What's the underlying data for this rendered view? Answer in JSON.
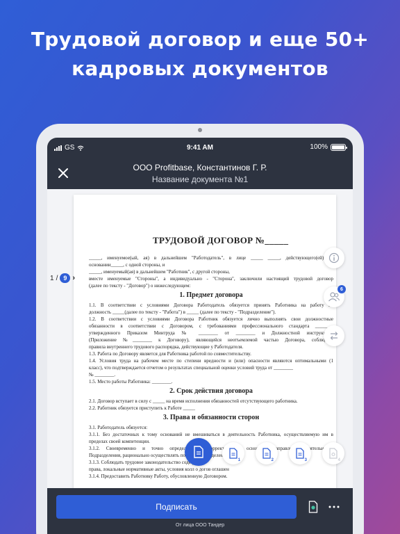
{
  "headline": {
    "line1": "Трудовой договор и еще 50+",
    "line2": "кадровых документов"
  },
  "status_bar": {
    "carrier": "GS",
    "time": "9:41 AM",
    "battery": "100%"
  },
  "header": {
    "title": "ООО Profitbase, Константинов Г. Р.",
    "subtitle": "Название документа №1"
  },
  "pager": {
    "current": "1",
    "separator": "/",
    "total": "9"
  },
  "document": {
    "title": "ТРУДОВОЙ ДОГОВОР №_____",
    "lines": [
      "_____, именуемое(ый, ая) в дальнейшем \"Работодатель\", в лице _____ _____, действующего(ей) на",
      "основании_____, с одной стороны, и",
      "_____, именуемый(ая) в дальнейшем \"Работник\", с другой стороны,",
      "вместе именуемые \"Стороны\", а индивидуально - \"Сторона\", заключили настоящий трудовой договор",
      "(далее по тексту - \"Договор\") о нижеследующем:"
    ],
    "section1": "1. Предмет договора",
    "section1_lines": [
      "1.1. В соответствии с условиями Договора Работодатель обязуется принять Работника на работу на",
      "должность _____(далее по тексту - \"Работа\") в _____ (далее по тексту - \"Подразделение\").",
      "1.2. В соответствии с условиями Договора Работник обязуется лично выполнять свои должностные",
      "обязанности в соответствии с Договором, с требованиями профессионального стандарта _______,",
      "утвержденного Приказом Минтруда № ________ от ________ и Должностной инструкцией",
      "(Приложение №________ к Договору), являющейся неотъемлемой частью Договора, соблюдать",
      "правила внутреннего трудового распорядка, действующие у Работодателя.",
      "1.3. Работа по Договору является для Работника работой по совместительству.",
      "1.4. Условия труда на рабочем месте по степени вредности и (или) опасности являются оптимальными (1",
      "класс), что подтверждается отчетом о результатах специальной оценки условий труда от ________",
      "№ ________.",
      "1.5. Место работы Работника: ________."
    ],
    "section2": "2. Срок действия договора",
    "section2_lines": [
      "2.1. Договор вступает в силу с _____ на время исполнения обязанностей отсутствующего работника.",
      "2.2. Работник обязуется приступить к Работе _____"
    ],
    "section3": "3. Права и обязанности сторон",
    "section3_lines": [
      "3.1. Работодатель обязуется:",
      "3.1.1. Без достаточных к тому оснований не вмешиваться в деятельность Работника, осуществляемую им в",
      "пределах своей компетенции.",
      "3.1.2. Своевременно и точно определять и корректировать основные направления деятельности",
      "Подразделения, рационально осуществлять постан                          и за           разделен",
      "3.1.3. Соблюдать трудовое законодательство                соде              рмы",
      "права, локальные нормативные акты, условия колл             о догов             оглашен",
      "3.1.4. Предоставить Работнику Работу, обусловленную Договором."
    ]
  },
  "doc_badges": {
    "b1": "1",
    "b2": "2",
    "b3": "3",
    "b4": "4"
  },
  "side": {
    "participants_count": "6"
  },
  "bottom": {
    "sign_label": "Подписать",
    "sign_note": "От лица ООО Тандер"
  },
  "colors": {
    "accent": "#2f5ed6",
    "dark_bar": "#2d3340"
  }
}
